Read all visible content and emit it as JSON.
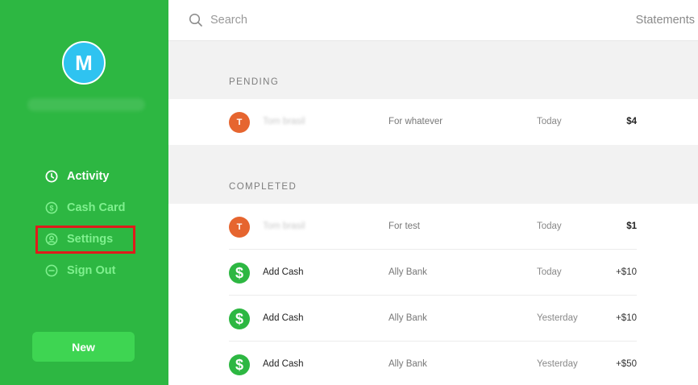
{
  "sidebar": {
    "avatar_letter": "M",
    "nav": [
      {
        "label": "Activity",
        "icon": "clock-icon",
        "state": "active"
      },
      {
        "label": "Cash Card",
        "icon": "dollar-circle-icon",
        "state": "muted"
      },
      {
        "label": "Settings",
        "icon": "user-circle-icon",
        "state": "muted"
      },
      {
        "label": "Sign Out",
        "icon": "minus-circle-icon",
        "state": "muted"
      }
    ],
    "new_label": "New"
  },
  "topbar": {
    "search_placeholder": "Search",
    "statements_label": "Statements"
  },
  "sections": {
    "pending_label": "PENDING",
    "completed_label": "COMPLETED"
  },
  "pending": [
    {
      "avatar": "T",
      "who": "Tom brasil",
      "desc": "For whatever",
      "when": "Today",
      "amount": "$4"
    }
  ],
  "completed": [
    {
      "avatar": "T",
      "who": "Tom brasil",
      "desc": "For test",
      "when": "Today",
      "amount": "$1"
    },
    {
      "avatar": "$",
      "who": "Add Cash",
      "desc": "Ally Bank",
      "when": "Today",
      "amount": "+$10"
    },
    {
      "avatar": "$",
      "who": "Add Cash",
      "desc": "Ally Bank",
      "when": "Yesterday",
      "amount": "+$10"
    },
    {
      "avatar": "$",
      "who": "Add Cash",
      "desc": "Ally Bank",
      "when": "Yesterday",
      "amount": "+$50"
    }
  ],
  "colors": {
    "sidebar_green": "#2db742",
    "avatar_blue": "#2fc3f0",
    "highlight_red": "#e01b1b",
    "orange_avatar": "#e6652f"
  }
}
